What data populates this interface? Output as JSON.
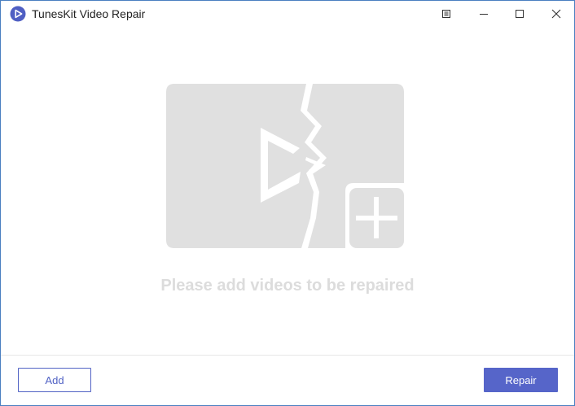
{
  "window": {
    "title": "TunesKit Video Repair"
  },
  "titlebar_buttons": {
    "menu_icon": "menu-list-icon",
    "minimize_icon": "minimize-icon",
    "maximize_icon": "maximize-icon",
    "close_icon": "close-icon"
  },
  "main": {
    "placeholder_icon": "broken-video-add-icon",
    "empty_message": "Please add videos to be repaired"
  },
  "footer": {
    "add_label": "Add",
    "repair_label": "Repair"
  },
  "colors": {
    "accent": "#5665c9",
    "window_border": "#4a7fc1",
    "placeholder_gray": "#e0e0e0",
    "message_gray": "#dcdcdc"
  }
}
